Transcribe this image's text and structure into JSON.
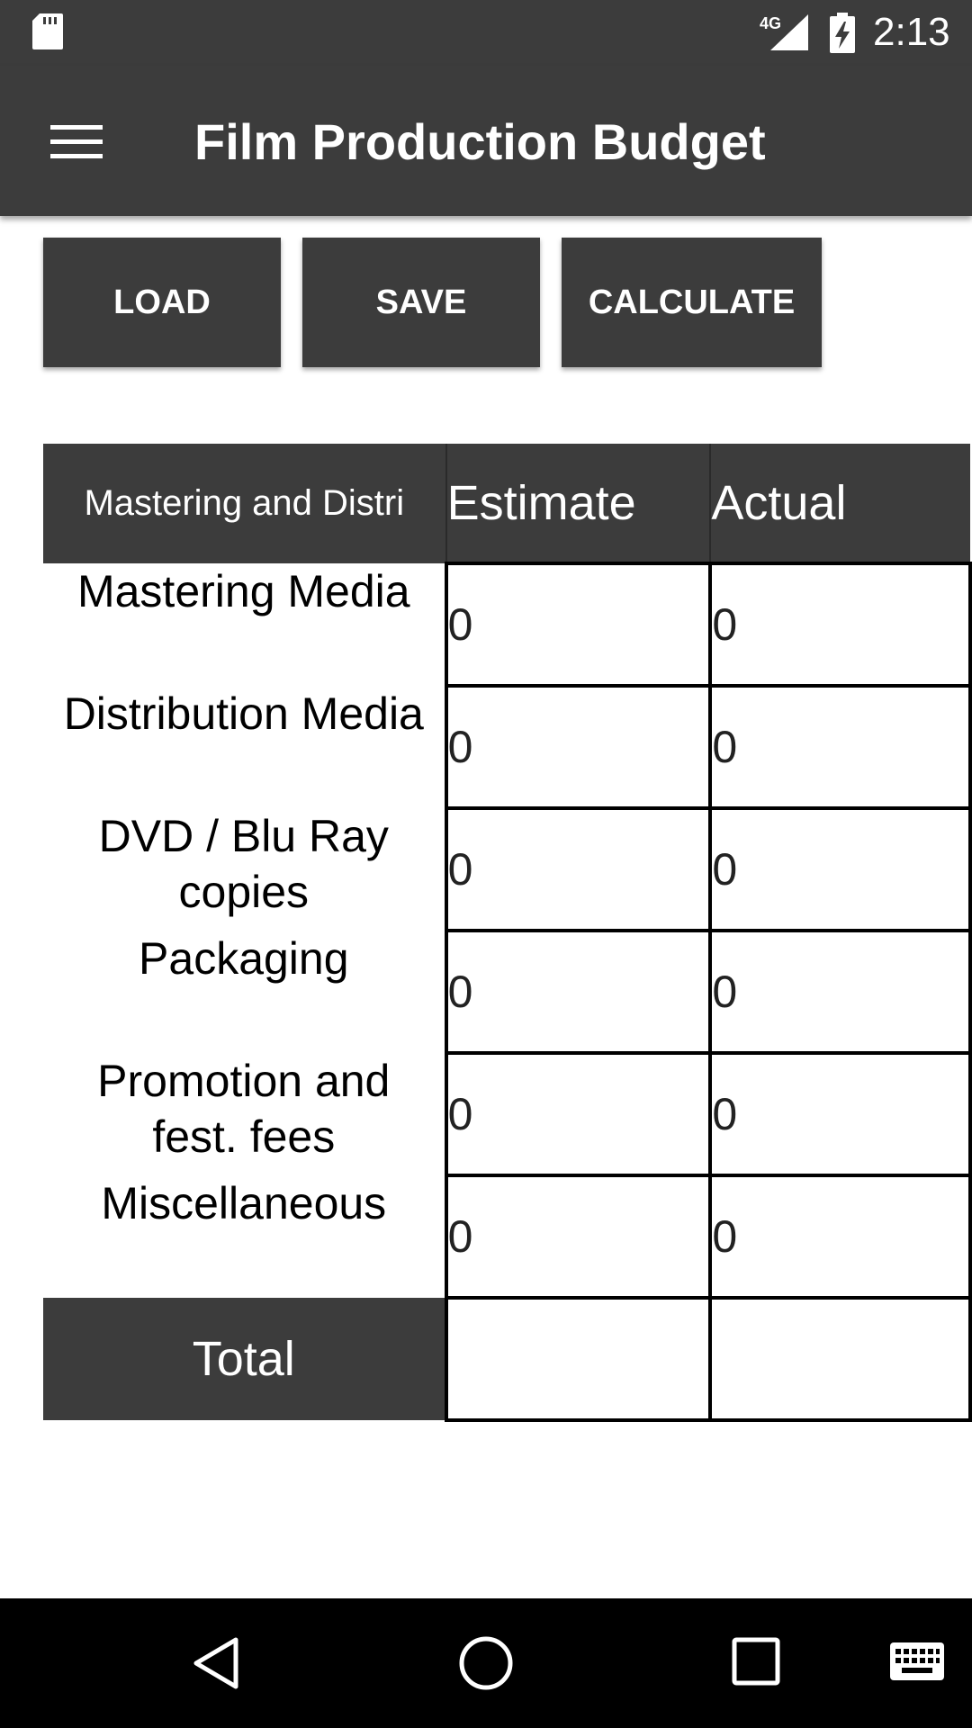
{
  "status_bar": {
    "time": "2:13",
    "network": "4G",
    "icons": [
      "sd-card-icon",
      "signal-icon",
      "battery-charging-icon"
    ]
  },
  "app_bar": {
    "title": "Film Production Budget",
    "menu_icon": "hamburger-menu-icon"
  },
  "toolbar": {
    "load_label": "LOAD",
    "save_label": "SAVE",
    "calculate_label": "CALCULATE"
  },
  "table": {
    "category_header": "Mastering and Distri",
    "estimate_header": "Estimate",
    "actual_header": "Actual",
    "rows": [
      {
        "label": "Mastering Media",
        "estimate": "0",
        "actual": "0"
      },
      {
        "label": "Distribution Media",
        "estimate": "0",
        "actual": "0"
      },
      {
        "label": "DVD / Blu Ray copies",
        "estimate": "0",
        "actual": "0"
      },
      {
        "label": "Packaging",
        "estimate": "0",
        "actual": "0"
      },
      {
        "label": "Promotion and fest. fees",
        "estimate": "0",
        "actual": "0"
      },
      {
        "label": "Miscellaneous",
        "estimate": "0",
        "actual": "0"
      }
    ],
    "total_label": "Total",
    "total_estimate": "",
    "total_actual": ""
  },
  "nav_bar": {
    "icons": [
      "back-icon",
      "home-icon",
      "recents-icon",
      "keyboard-icon"
    ]
  },
  "colors": {
    "bar": "#3c3c3c",
    "nav": "#000000",
    "background": "#ffffff"
  }
}
